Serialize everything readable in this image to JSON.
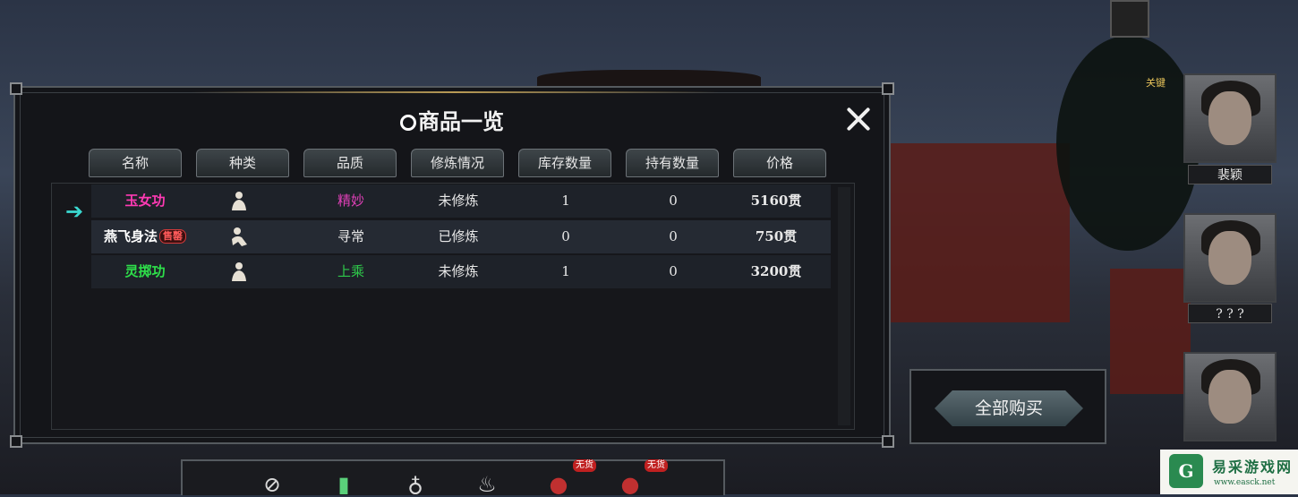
{
  "dialog": {
    "title": "商品一览",
    "close_icon": "close-icon"
  },
  "columns": [
    "名称",
    "种类",
    "品质",
    "修炼情况",
    "库存数量",
    "持有数量",
    "价格"
  ],
  "items": [
    {
      "name": "玉女功",
      "name_color": "#ff3ab4",
      "type_icon": "meditating-figure-icon",
      "quality": "精妙",
      "quality_color": "#e040b8",
      "status": "未修炼",
      "stock": "1",
      "held": "0",
      "price": "5160贯",
      "badge": ""
    },
    {
      "name": "燕飞身法",
      "name_color": "#ffffff",
      "type_icon": "movement-figure-icon",
      "quality": "寻常",
      "quality_color": "#e8e8e8",
      "status": "已修炼",
      "stock": "0",
      "held": "0",
      "price": "750贯",
      "badge": "售罄"
    },
    {
      "name": "灵掷功",
      "name_color": "#2ee04a",
      "type_icon": "meditating-figure-icon",
      "quality": "上乘",
      "quality_color": "#2ec84a",
      "status": "未修炼",
      "stock": "1",
      "held": "0",
      "price": "3200贯",
      "badge": ""
    }
  ],
  "buy_all_label": "全部购买",
  "affinity_label": "关键",
  "portraits": [
    {
      "name": "裴颖"
    },
    {
      "name": "? ? ?"
    }
  ],
  "toolbar": [
    {
      "icon": "no-food-icon",
      "badge": ""
    },
    {
      "icon": "cards-icon",
      "badge": ""
    },
    {
      "icon": "pouch-icon",
      "badge": ""
    },
    {
      "icon": "hot-spring-icon",
      "badge": ""
    },
    {
      "icon": "teapot-icon",
      "badge": "无货"
    },
    {
      "icon": "wine-jar-icon",
      "badge": "无货"
    }
  ],
  "watermark": {
    "text": "易采游戏网",
    "url": "www.easck.net"
  },
  "colors": {
    "accent": "#3ad8d0",
    "panel": "#141519",
    "border": "#555a5f"
  }
}
